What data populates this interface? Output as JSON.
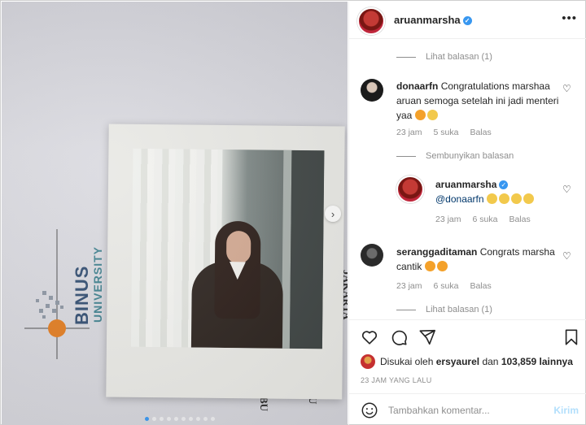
{
  "post": {
    "author": "aruanmarsha",
    "menu_icon": "more-horizontal-icon",
    "photo": {
      "university_name": "BINUS",
      "university_sub": "UNIVERSITY",
      "side_text_right": "JAKARTA",
      "bottom_text_left": "BU",
      "bottom_text_right": "U",
      "carousel_dots": 10,
      "active_dot": 0
    }
  },
  "comments": {
    "top_replies_toggle": "Lihat balasan (1)",
    "items": [
      {
        "username": "donaarfn",
        "text": "Congratulations marshaa aruan semoga setelah ini jadi menteri yaa",
        "time": "23 jam",
        "likes": "5 suka",
        "reply_label": "Balas"
      },
      {
        "hide_replies_toggle": "Sembunyikan balasan"
      },
      {
        "username": "aruanmarsha",
        "mention": "@donaarfn",
        "time": "23 jam",
        "likes": "6 suka",
        "reply_label": "Balas"
      },
      {
        "username": "seranggaditaman",
        "text": "Congrats marsha cantik",
        "time": "23 jam",
        "likes": "6 suka",
        "reply_label": "Balas"
      }
    ],
    "bottom_replies_toggle": "Lihat balasan (1)"
  },
  "footer": {
    "liked_by_prefix": "Disukai oleh",
    "liked_by_user": "ersyaurel",
    "liked_by_and": "dan",
    "liked_by_count": "103,859 lainnya",
    "time_ago": "23 JAM YANG LALU",
    "comment_placeholder": "Tambahkan komentar...",
    "post_label": "Kirim"
  },
  "colors": {
    "accent": "#3897f0",
    "muted": "#8e8e8e",
    "post_disabled": "#b2dffc"
  }
}
